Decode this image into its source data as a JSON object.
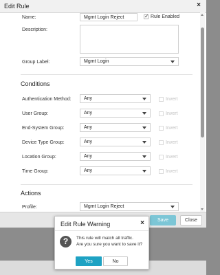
{
  "dialog": {
    "title": "Edit Rule",
    "close_glyph": "×"
  },
  "form": {
    "name_label": "Name:",
    "name_value": "Mgmt Login Reject",
    "rule_enabled_label": "Rule Enabled",
    "rule_enabled_checked": true,
    "description_label": "Description:",
    "description_value": "",
    "group_label_label": "Group Label:",
    "group_label_value": "Mgmt Login"
  },
  "conditions": {
    "heading": "Conditions",
    "invert_label": "Invert",
    "rows": [
      {
        "label": "Authentication Method:",
        "value": "Any"
      },
      {
        "label": "User Group:",
        "value": "Any"
      },
      {
        "label": "End-System Group:",
        "value": "Any"
      },
      {
        "label": "Device Type Group:",
        "value": "Any"
      },
      {
        "label": "Location Group:",
        "value": "Any"
      },
      {
        "label": "Time Group:",
        "value": "Any"
      }
    ]
  },
  "actions": {
    "heading": "Actions",
    "profile_label": "Profile:",
    "profile_value": "Mgmt Login Reject"
  },
  "footer": {
    "save_label": "Save",
    "close_label": "Close"
  },
  "warning": {
    "title": "Edit Rule Warning",
    "close_glyph": "×",
    "icon_glyph": "?",
    "message_line1": "This rule will match all traffic.",
    "message_line2": "Are you sure you want to save it?",
    "yes_label": "Yes",
    "no_label": "No"
  },
  "colors": {
    "save_button": "#7cc6d6",
    "yes_button": "#1ea2c3",
    "question_icon": "#555555"
  }
}
